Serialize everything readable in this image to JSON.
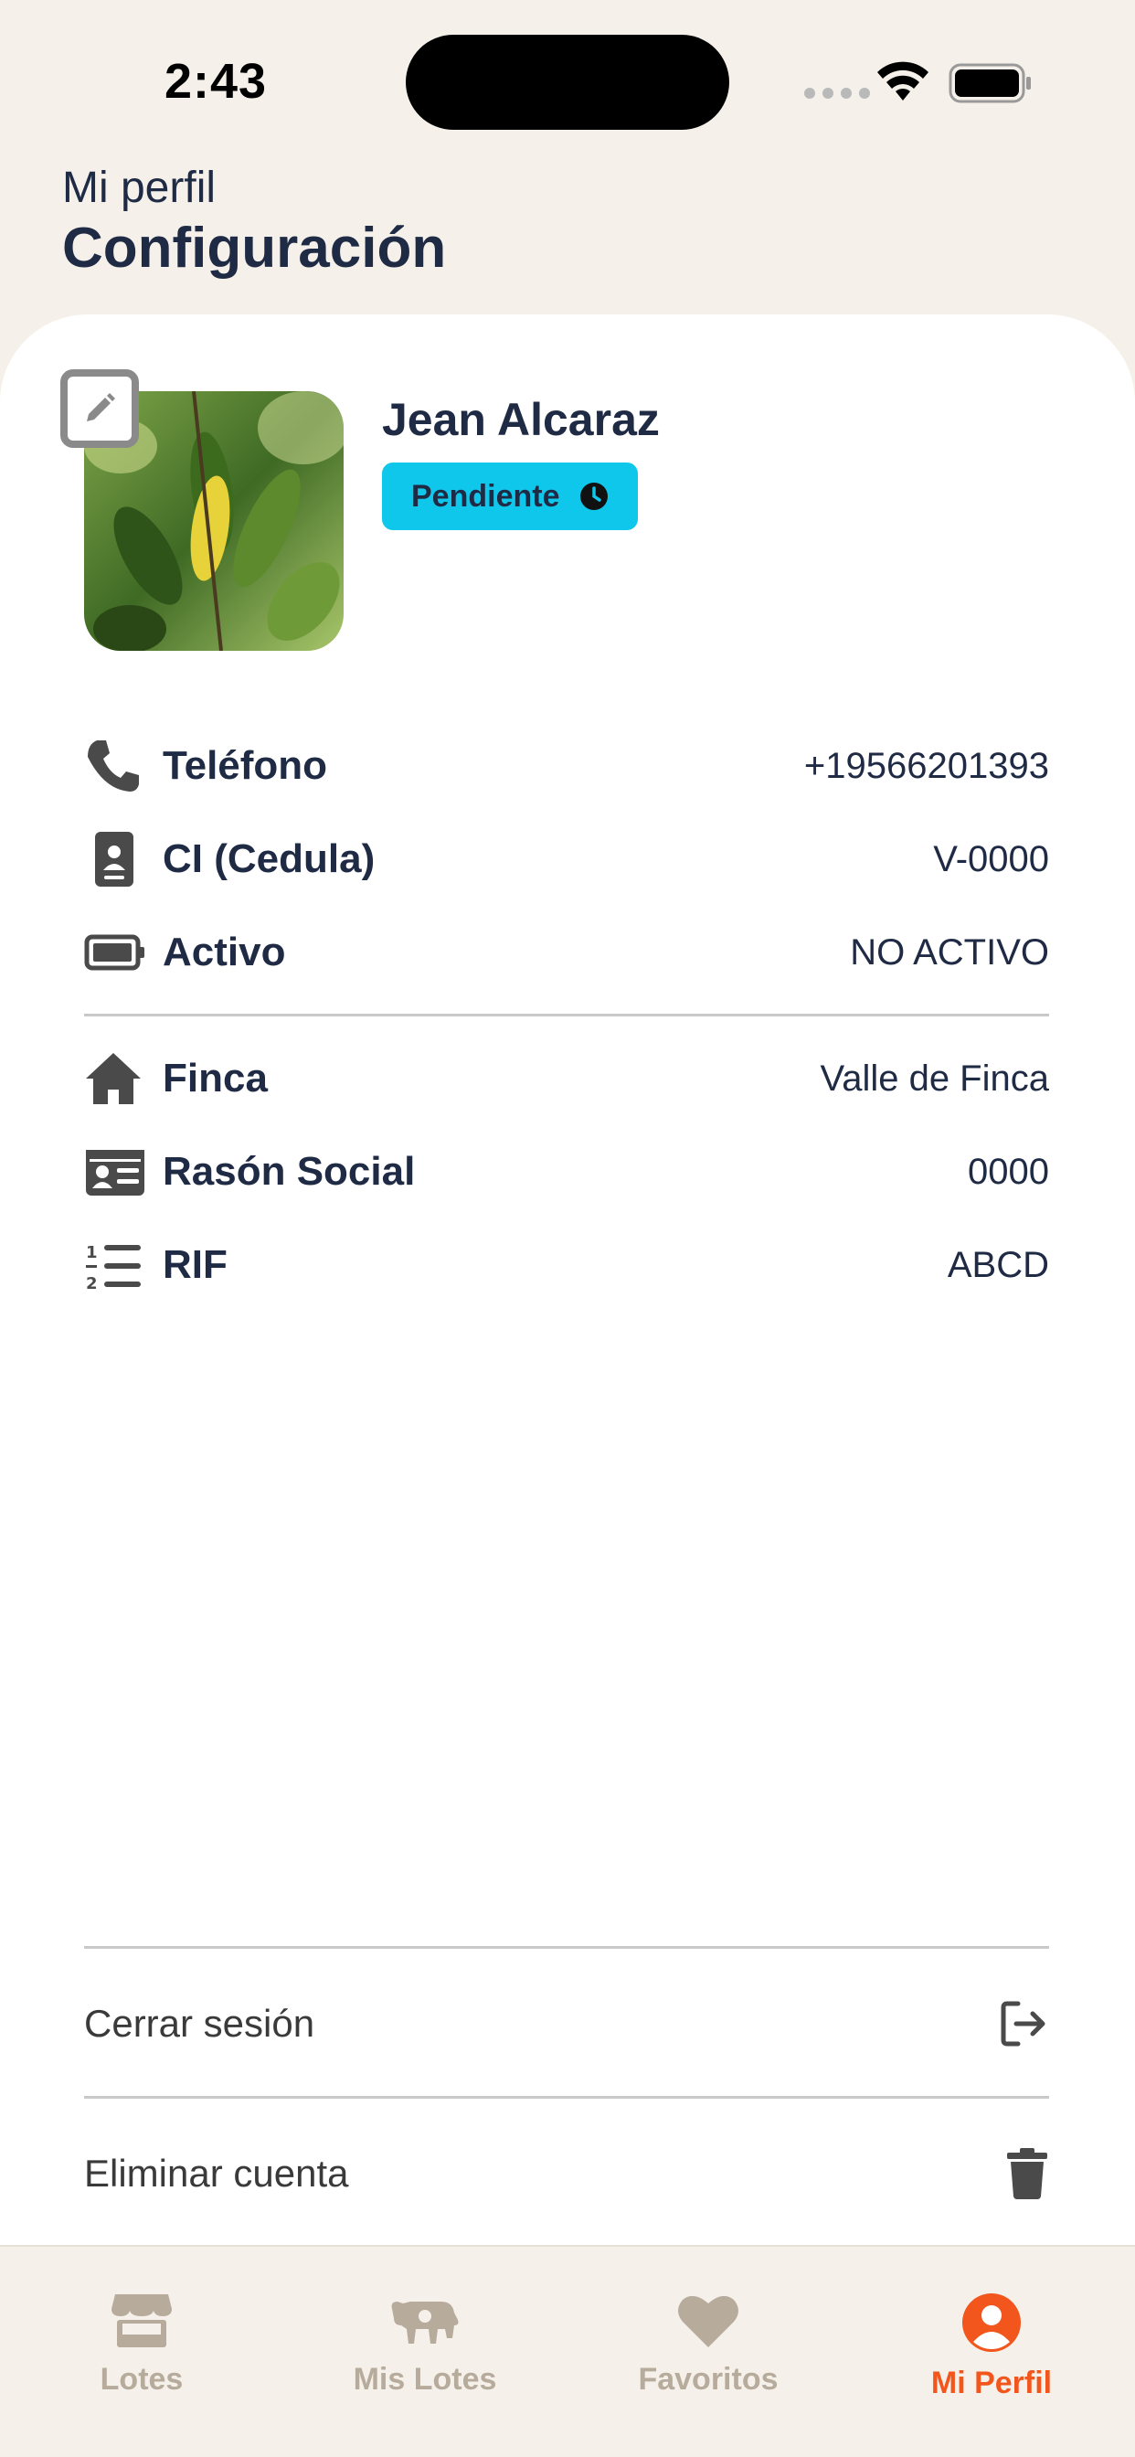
{
  "status_bar": {
    "time": "2:43"
  },
  "header": {
    "subtitle": "Mi perfil",
    "title": "Configuración"
  },
  "profile": {
    "name": "Jean Alcaraz",
    "status_label": "Pendiente"
  },
  "personal_info": [
    {
      "icon": "phone-icon",
      "label": "Teléfono",
      "value": "+19566201393"
    },
    {
      "icon": "id-badge-icon",
      "label": "CI (Cedula)",
      "value": "V-0000"
    },
    {
      "icon": "battery-icon",
      "label": "Activo",
      "value": "NO ACTIVO"
    }
  ],
  "business_info": [
    {
      "icon": "home-icon",
      "label": "Finca",
      "value": "Valle de Finca"
    },
    {
      "icon": "id-card-icon",
      "label": "Rasón Social",
      "value": "0000"
    },
    {
      "icon": "numbered-list-icon",
      "label": "RIF",
      "value": "ABCD"
    }
  ],
  "actions": {
    "logout_label": "Cerrar sesión",
    "delete_label": "Eliminar cuenta"
  },
  "tabs": [
    {
      "label": "Lotes",
      "icon": "store-icon",
      "active": false
    },
    {
      "label": "Mis Lotes",
      "icon": "cow-icon",
      "active": false
    },
    {
      "label": "Favoritos",
      "icon": "heart-icon",
      "active": false
    },
    {
      "label": "Mi Perfil",
      "icon": "user-circle-icon",
      "active": true
    }
  ],
  "colors": {
    "accent": "#f2561d",
    "badge": "#0fc7ea",
    "text": "#1f2a44",
    "background": "#f5f1ea"
  }
}
